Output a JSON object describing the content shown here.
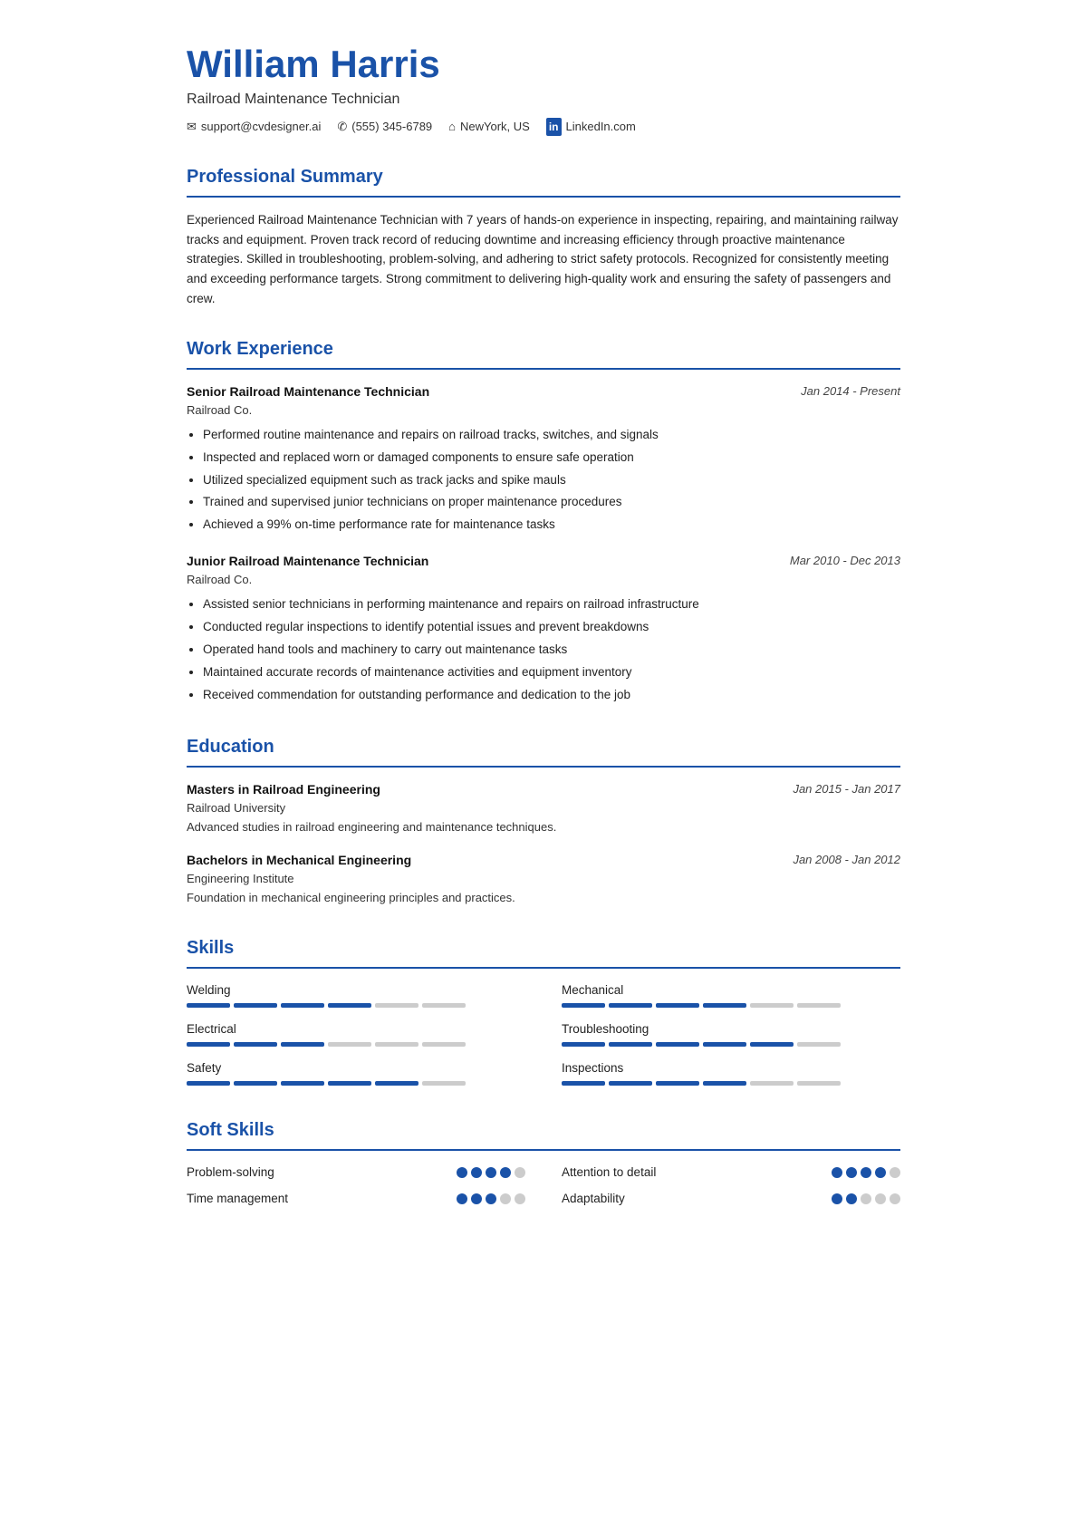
{
  "header": {
    "name": "William Harris",
    "title": "Railroad Maintenance Technician",
    "contacts": [
      {
        "icon": "✉",
        "text": "support@cvdesigner.ai",
        "type": "email"
      },
      {
        "icon": "✆",
        "text": "(555) 345-6789",
        "type": "phone"
      },
      {
        "icon": "⌂",
        "text": "NewYork, US",
        "type": "location"
      },
      {
        "icon": "in",
        "text": "LinkedIn.com",
        "type": "linkedin"
      }
    ]
  },
  "sections": {
    "summary": {
      "title": "Professional Summary",
      "text": "Experienced Railroad Maintenance Technician with 7 years of hands-on experience in inspecting, repairing, and maintaining railway tracks and equipment. Proven track record of reducing downtime and increasing efficiency through proactive maintenance strategies. Skilled in troubleshooting, problem-solving, and adhering to strict safety protocols. Recognized for consistently meeting and exceeding performance targets. Strong commitment to delivering high-quality work and ensuring the safety of passengers and crew."
    },
    "work_experience": {
      "title": "Work Experience",
      "jobs": [
        {
          "title": "Senior Railroad Maintenance Technician",
          "company": "Railroad Co.",
          "date": "Jan 2014 - Present",
          "bullets": [
            "Performed routine maintenance and repairs on railroad tracks, switches, and signals",
            "Inspected and replaced worn or damaged components to ensure safe operation",
            "Utilized specialized equipment such as track jacks and spike mauls",
            "Trained and supervised junior technicians on proper maintenance procedures",
            "Achieved a 99% on-time performance rate for maintenance tasks"
          ]
        },
        {
          "title": "Junior Railroad Maintenance Technician",
          "company": "Railroad Co.",
          "date": "Mar 2010 - Dec 2013",
          "bullets": [
            "Assisted senior technicians in performing maintenance and repairs on railroad infrastructure",
            "Conducted regular inspections to identify potential issues and prevent breakdowns",
            "Operated hand tools and machinery to carry out maintenance tasks",
            "Maintained accurate records of maintenance activities and equipment inventory",
            "Received commendation for outstanding performance and dedication to the job"
          ]
        }
      ]
    },
    "education": {
      "title": "Education",
      "items": [
        {
          "degree": "Masters in Railroad Engineering",
          "school": "Railroad University",
          "date": "Jan 2015 - Jan 2017",
          "desc": "Advanced studies in railroad engineering and maintenance techniques."
        },
        {
          "degree": "Bachelors in Mechanical Engineering",
          "school": "Engineering Institute",
          "date": "Jan 2008 - Jan 2012",
          "desc": "Foundation in mechanical engineering principles and practices."
        }
      ]
    },
    "skills": {
      "title": "Skills",
      "items": [
        {
          "name": "Welding",
          "filled": 4,
          "total": 6
        },
        {
          "name": "Mechanical",
          "filled": 4,
          "total": 6
        },
        {
          "name": "Electrical",
          "filled": 3,
          "total": 6
        },
        {
          "name": "Troubleshooting",
          "filled": 5,
          "total": 6
        },
        {
          "name": "Safety",
          "filled": 5,
          "total": 6
        },
        {
          "name": "Inspections",
          "filled": 4,
          "total": 6
        }
      ]
    },
    "soft_skills": {
      "title": "Soft Skills",
      "items": [
        {
          "name": "Problem-solving",
          "filled": 4,
          "total": 5
        },
        {
          "name": "Attention to detail",
          "filled": 4,
          "total": 5
        },
        {
          "name": "Time management",
          "filled": 3,
          "total": 5
        },
        {
          "name": "Adaptability",
          "filled": 2,
          "total": 5
        }
      ]
    }
  }
}
